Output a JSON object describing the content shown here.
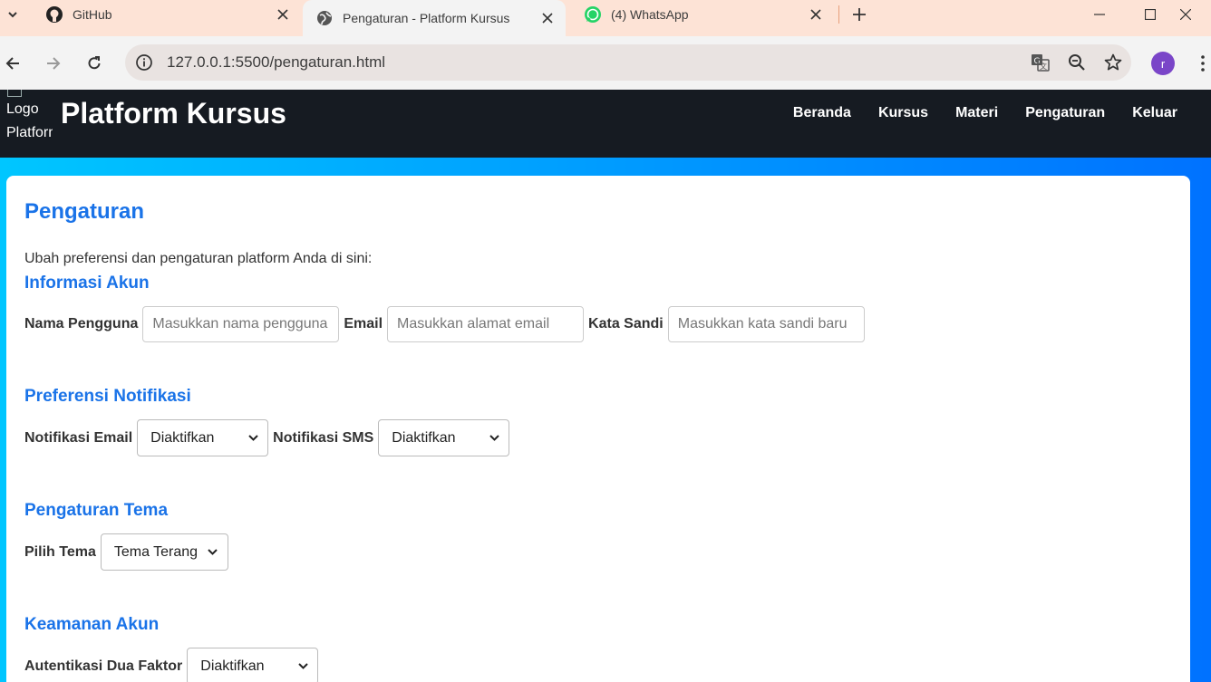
{
  "browser": {
    "tabs": [
      {
        "title": "GitHub",
        "icon": "github-icon"
      },
      {
        "title": "Pengaturan - Platform Kursus",
        "icon": "globe-icon"
      },
      {
        "title": "(4) WhatsApp",
        "icon": "whatsapp-icon"
      }
    ],
    "url": "127.0.0.1:5500/pengaturan.html",
    "profile_initial": "r"
  },
  "header": {
    "logo_alt": "Logo\nPlatform",
    "brand": "Platform Kursus",
    "nav": [
      "Beranda",
      "Kursus",
      "Materi",
      "Pengaturan",
      "Keluar"
    ]
  },
  "page": {
    "title": "Pengaturan",
    "intro": "Ubah preferensi dan pengaturan platform Anda di sini:",
    "account": {
      "heading": "Informasi Akun",
      "username_label": "Nama Pengguna",
      "username_placeholder": "Masukkan nama pengguna",
      "email_label": "Email",
      "email_placeholder": "Masukkan alamat email",
      "password_label": "Kata Sandi",
      "password_placeholder": "Masukkan kata sandi baru"
    },
    "notifications": {
      "heading": "Preferensi Notifikasi",
      "email_label": "Notifikasi Email",
      "email_value": "Diaktifkan",
      "sms_label": "Notifikasi SMS",
      "sms_value": "Diaktifkan"
    },
    "theme": {
      "heading": "Pengaturan Tema",
      "label": "Pilih Tema",
      "value": "Tema Terang"
    },
    "security": {
      "heading": "Keamanan Akun",
      "twofa_label": "Autentikasi Dua Faktor",
      "twofa_value": "Diaktifkan"
    }
  },
  "colors": {
    "accent": "#1a73e8",
    "header_bg": "#161b22",
    "gradient_start": "#00c6ff",
    "gradient_end": "#0072ff",
    "tabstrip": "#fde3d6"
  }
}
